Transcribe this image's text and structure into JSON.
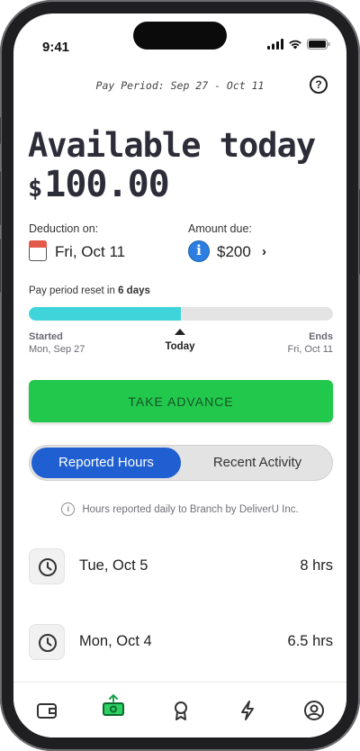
{
  "status_bar": {
    "time": "9:41"
  },
  "header": {
    "pay_period": "Pay Period: Sep 27 - Oct 11"
  },
  "available": {
    "label": "Available today",
    "currency": "$",
    "amount": "100.00"
  },
  "deduction": {
    "label": "Deduction on:",
    "date": "Fri, Oct 11"
  },
  "amount_due": {
    "label": "Amount due:",
    "value": "$200"
  },
  "progress": {
    "reset_prefix": "Pay period reset in",
    "reset_days": "6 days",
    "fraction": 0.5,
    "started_label": "Started",
    "started_date": "Mon, Sep 27",
    "today_label": "Today",
    "ends_label": "Ends",
    "ends_date": "Fri, Oct 11"
  },
  "advance_button": {
    "label": "TAKE ADVANCE"
  },
  "tabs": {
    "reported_hours": "Reported Hours",
    "recent_activity": "Recent Activity",
    "active": "reported_hours"
  },
  "note": {
    "text": "Hours reported daily to Branch by DeliverU Inc."
  },
  "hours": [
    {
      "date": "Tue, Oct 5",
      "hours": "8 hrs"
    },
    {
      "date": "Mon, Oct 4",
      "hours": "6.5 hrs"
    }
  ],
  "nav": [
    {
      "icon": "wallet-icon"
    },
    {
      "icon": "cash-advance-icon",
      "active": true
    },
    {
      "icon": "award-icon"
    },
    {
      "icon": "lightning-icon"
    },
    {
      "icon": "profile-icon"
    }
  ],
  "colors": {
    "accent_green": "#22c84b",
    "progress_fill": "#3fd4d9",
    "tab_active": "#1f5fd1",
    "info_blue": "#2d7ee3",
    "active_nav": "#1aa34a"
  }
}
